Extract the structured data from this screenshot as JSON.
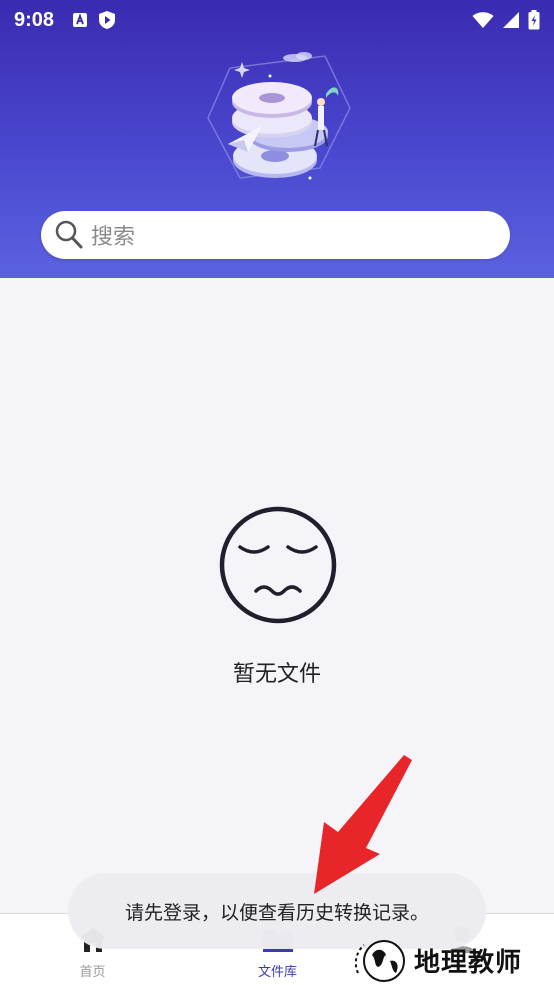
{
  "status_bar": {
    "time": "9:08",
    "left_icons": [
      "font-icon",
      "shield-play-icon"
    ],
    "right_icons": [
      "wifi-icon",
      "signal-icon",
      "battery-icon"
    ]
  },
  "search": {
    "placeholder": "搜索"
  },
  "empty_state": {
    "message": "暂无文件"
  },
  "tabs": [
    {
      "label": "首页",
      "icon": "home-icon",
      "active": false
    },
    {
      "label": "文件库",
      "icon": "folder-icon",
      "active": true
    },
    {
      "label": "",
      "icon": "user-icon",
      "active": false
    }
  ],
  "toast": {
    "message": "请先登录，以便查看历史转换记录。"
  },
  "watermark": {
    "text": "地理教师"
  },
  "colors": {
    "header_top": "#3a2bb0",
    "header_bottom": "#5b62e0",
    "active_tab": "#3c3ab5",
    "arrow": "#e8262a",
    "background": "#f4f4f9"
  }
}
